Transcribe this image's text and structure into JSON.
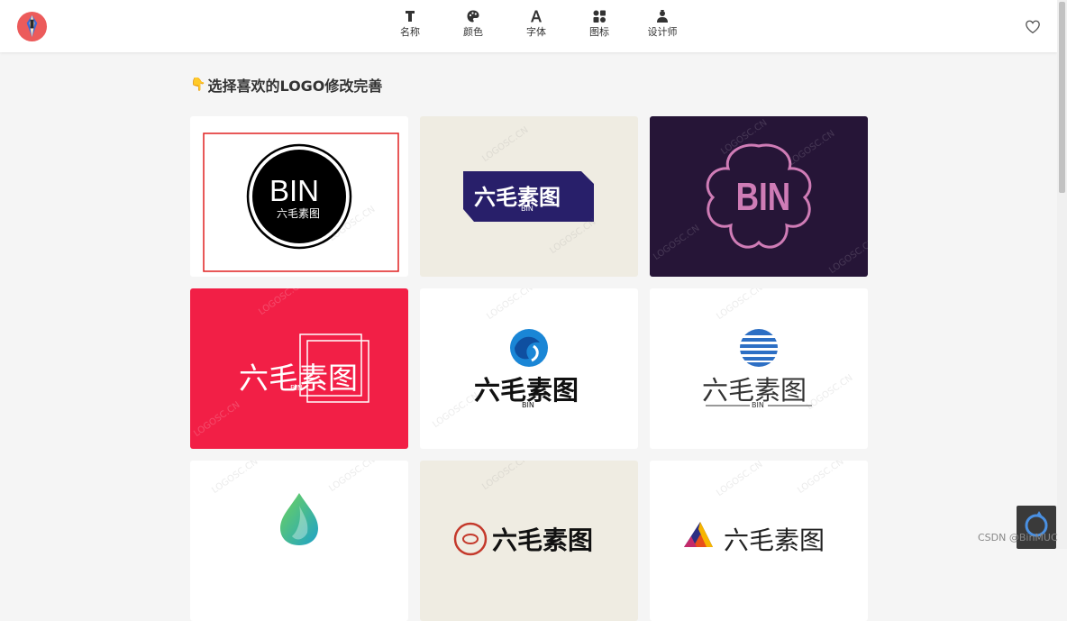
{
  "header": {
    "nav": [
      {
        "label": "名称",
        "icon": "text-t-icon"
      },
      {
        "label": "颜色",
        "icon": "palette-icon"
      },
      {
        "label": "字体",
        "icon": "font-a-icon"
      },
      {
        "label": "图标",
        "icon": "shapes-icon"
      },
      {
        "label": "设计师",
        "icon": "designer-icon"
      }
    ]
  },
  "title": "选择喜欢的LOGO修改完善",
  "watermark": "LOGOSC.CN",
  "cards": [
    {
      "brand": "六毛素图",
      "sub": "BIN",
      "short": "BIN",
      "bg": "#ffffff",
      "selected": true
    },
    {
      "brand": "六毛素图",
      "sub": "BIN",
      "bg": "#efece2",
      "accent": "#281f6a"
    },
    {
      "short": "BIN",
      "bg": "#261537",
      "accent": "#cf7cb6"
    },
    {
      "brand": "六毛素图",
      "sub": "BIN",
      "bg": "#f21f46"
    },
    {
      "brand": "六毛素图",
      "sub": "BIN",
      "bg": "#ffffff",
      "accent": "#1a86d6"
    },
    {
      "brand": "六毛素图",
      "sub": "BIN",
      "bg": "#ffffff",
      "accent": "#2d6fc4"
    },
    {
      "bg": "#ffffff",
      "accent": "#2bb5a0"
    },
    {
      "brand": "六毛素图",
      "bg": "#efece2",
      "accent": "#c4392b"
    },
    {
      "brand": "六毛素图",
      "bg": "#ffffff",
      "accent": "#e94e1b"
    }
  ],
  "footer": {
    "csdn": "CSDN @BinMUC"
  }
}
